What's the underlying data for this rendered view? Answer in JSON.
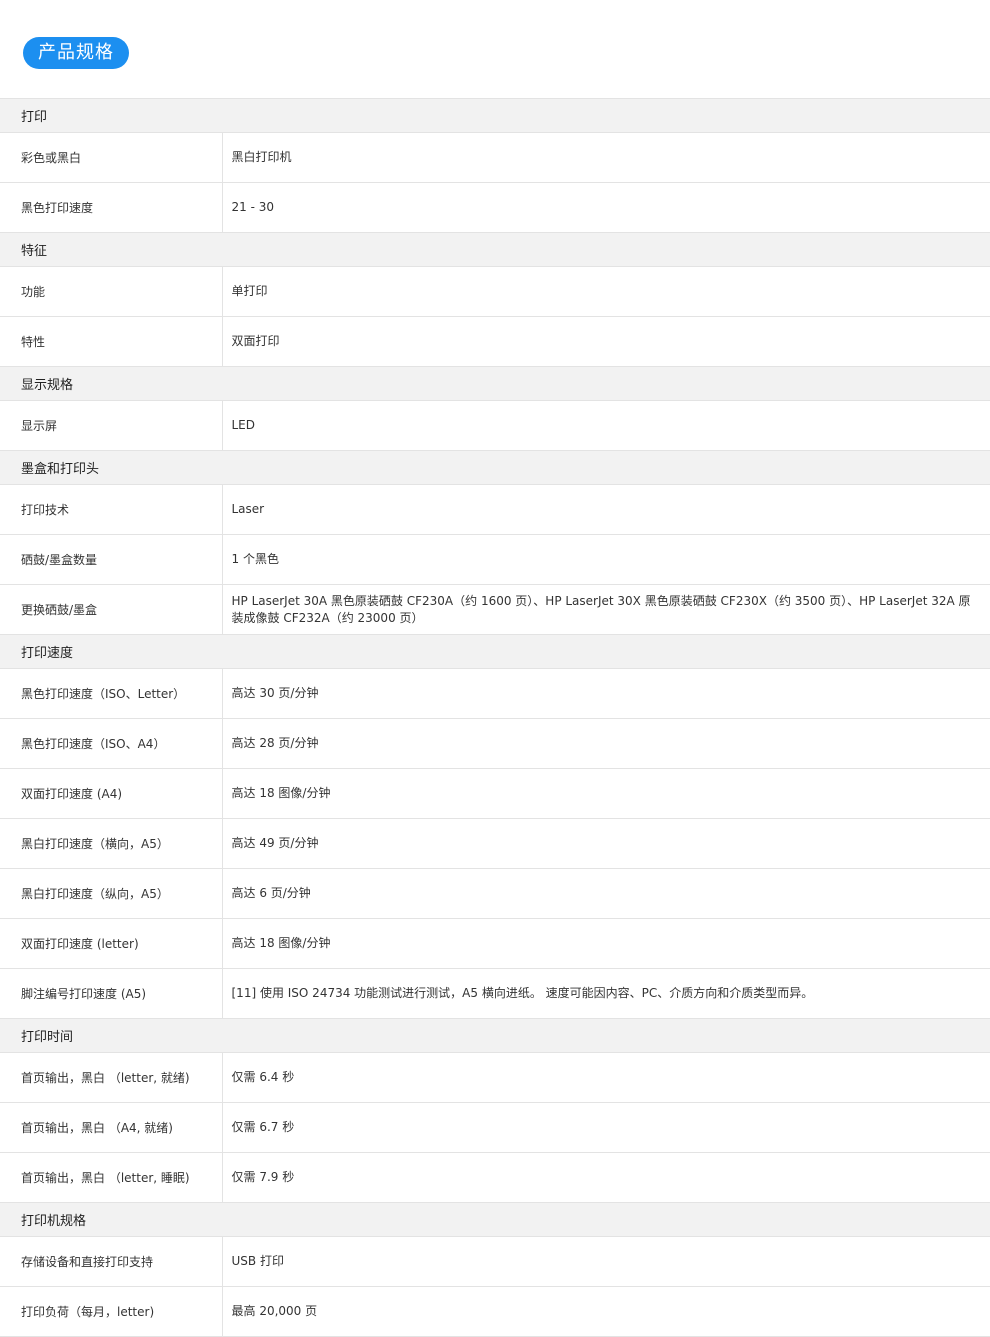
{
  "title": "产品规格",
  "sections": [
    {
      "heading": "打印",
      "rows": [
        {
          "label": "彩色或黑白",
          "value": "黑白打印机"
        },
        {
          "label": "黑色打印速度",
          "value": "21 - 30"
        }
      ]
    },
    {
      "heading": "特征",
      "rows": [
        {
          "label": "功能",
          "value": "单打印"
        },
        {
          "label": "特性",
          "value": "双面打印"
        }
      ]
    },
    {
      "heading": "显示规格",
      "rows": [
        {
          "label": "显示屏",
          "value": "LED"
        }
      ]
    },
    {
      "heading": "墨盒和打印头",
      "rows": [
        {
          "label": "打印技术",
          "value": "Laser"
        },
        {
          "label": "硒鼓/墨盒数量",
          "value": "1 个黑色"
        },
        {
          "label": "更换硒鼓/墨盒",
          "value": "HP LaserJet 30A 黑色原装硒鼓 CF230A（约 1600 页）、HP LaserJet 30X 黑色原装硒鼓 CF230X（约 3500 页）、HP LaserJet 32A 原装成像鼓 CF232A（约 23000 页）"
        }
      ]
    },
    {
      "heading": "打印速度",
      "rows": [
        {
          "label": "黑色打印速度（ISO、Letter）",
          "value": "高达 30 页/分钟"
        },
        {
          "label": "黑色打印速度（ISO、A4）",
          "value": "高达 28 页/分钟"
        },
        {
          "label": "双面打印速度 (A4)",
          "value": "高达 18 图像/分钟"
        },
        {
          "label": "黑白打印速度（横向，A5）",
          "value": "高达 49 页/分钟"
        },
        {
          "label": "黑白打印速度（纵向，A5）",
          "value": "高达 6 页/分钟"
        },
        {
          "label": "双面打印速度 (letter)",
          "value": "高达 18 图像/分钟"
        },
        {
          "label": "脚注编号打印速度 (A5)",
          "value": "[11] 使用 ISO 24734 功能测试进行测试，A5 横向进纸。 速度可能因内容、PC、介质方向和介质类型而异。"
        }
      ]
    },
    {
      "heading": "打印时间",
      "rows": [
        {
          "label": "首页输出，黑白 （letter, 就绪)",
          "value": "仅需 6.4 秒"
        },
        {
          "label": "首页输出，黑白 （A4, 就绪)",
          "value": "仅需 6.7 秒"
        },
        {
          "label": "首页输出，黑白 （letter, 睡眠)",
          "value": "仅需 7.9 秒"
        }
      ]
    },
    {
      "heading": "打印机规格",
      "rows": [
        {
          "label": "存储设备和直接打印支持",
          "value": "USB 打印"
        },
        {
          "label": "打印负荷（每月，letter)",
          "value": "最高 20,000 页"
        }
      ]
    }
  ]
}
